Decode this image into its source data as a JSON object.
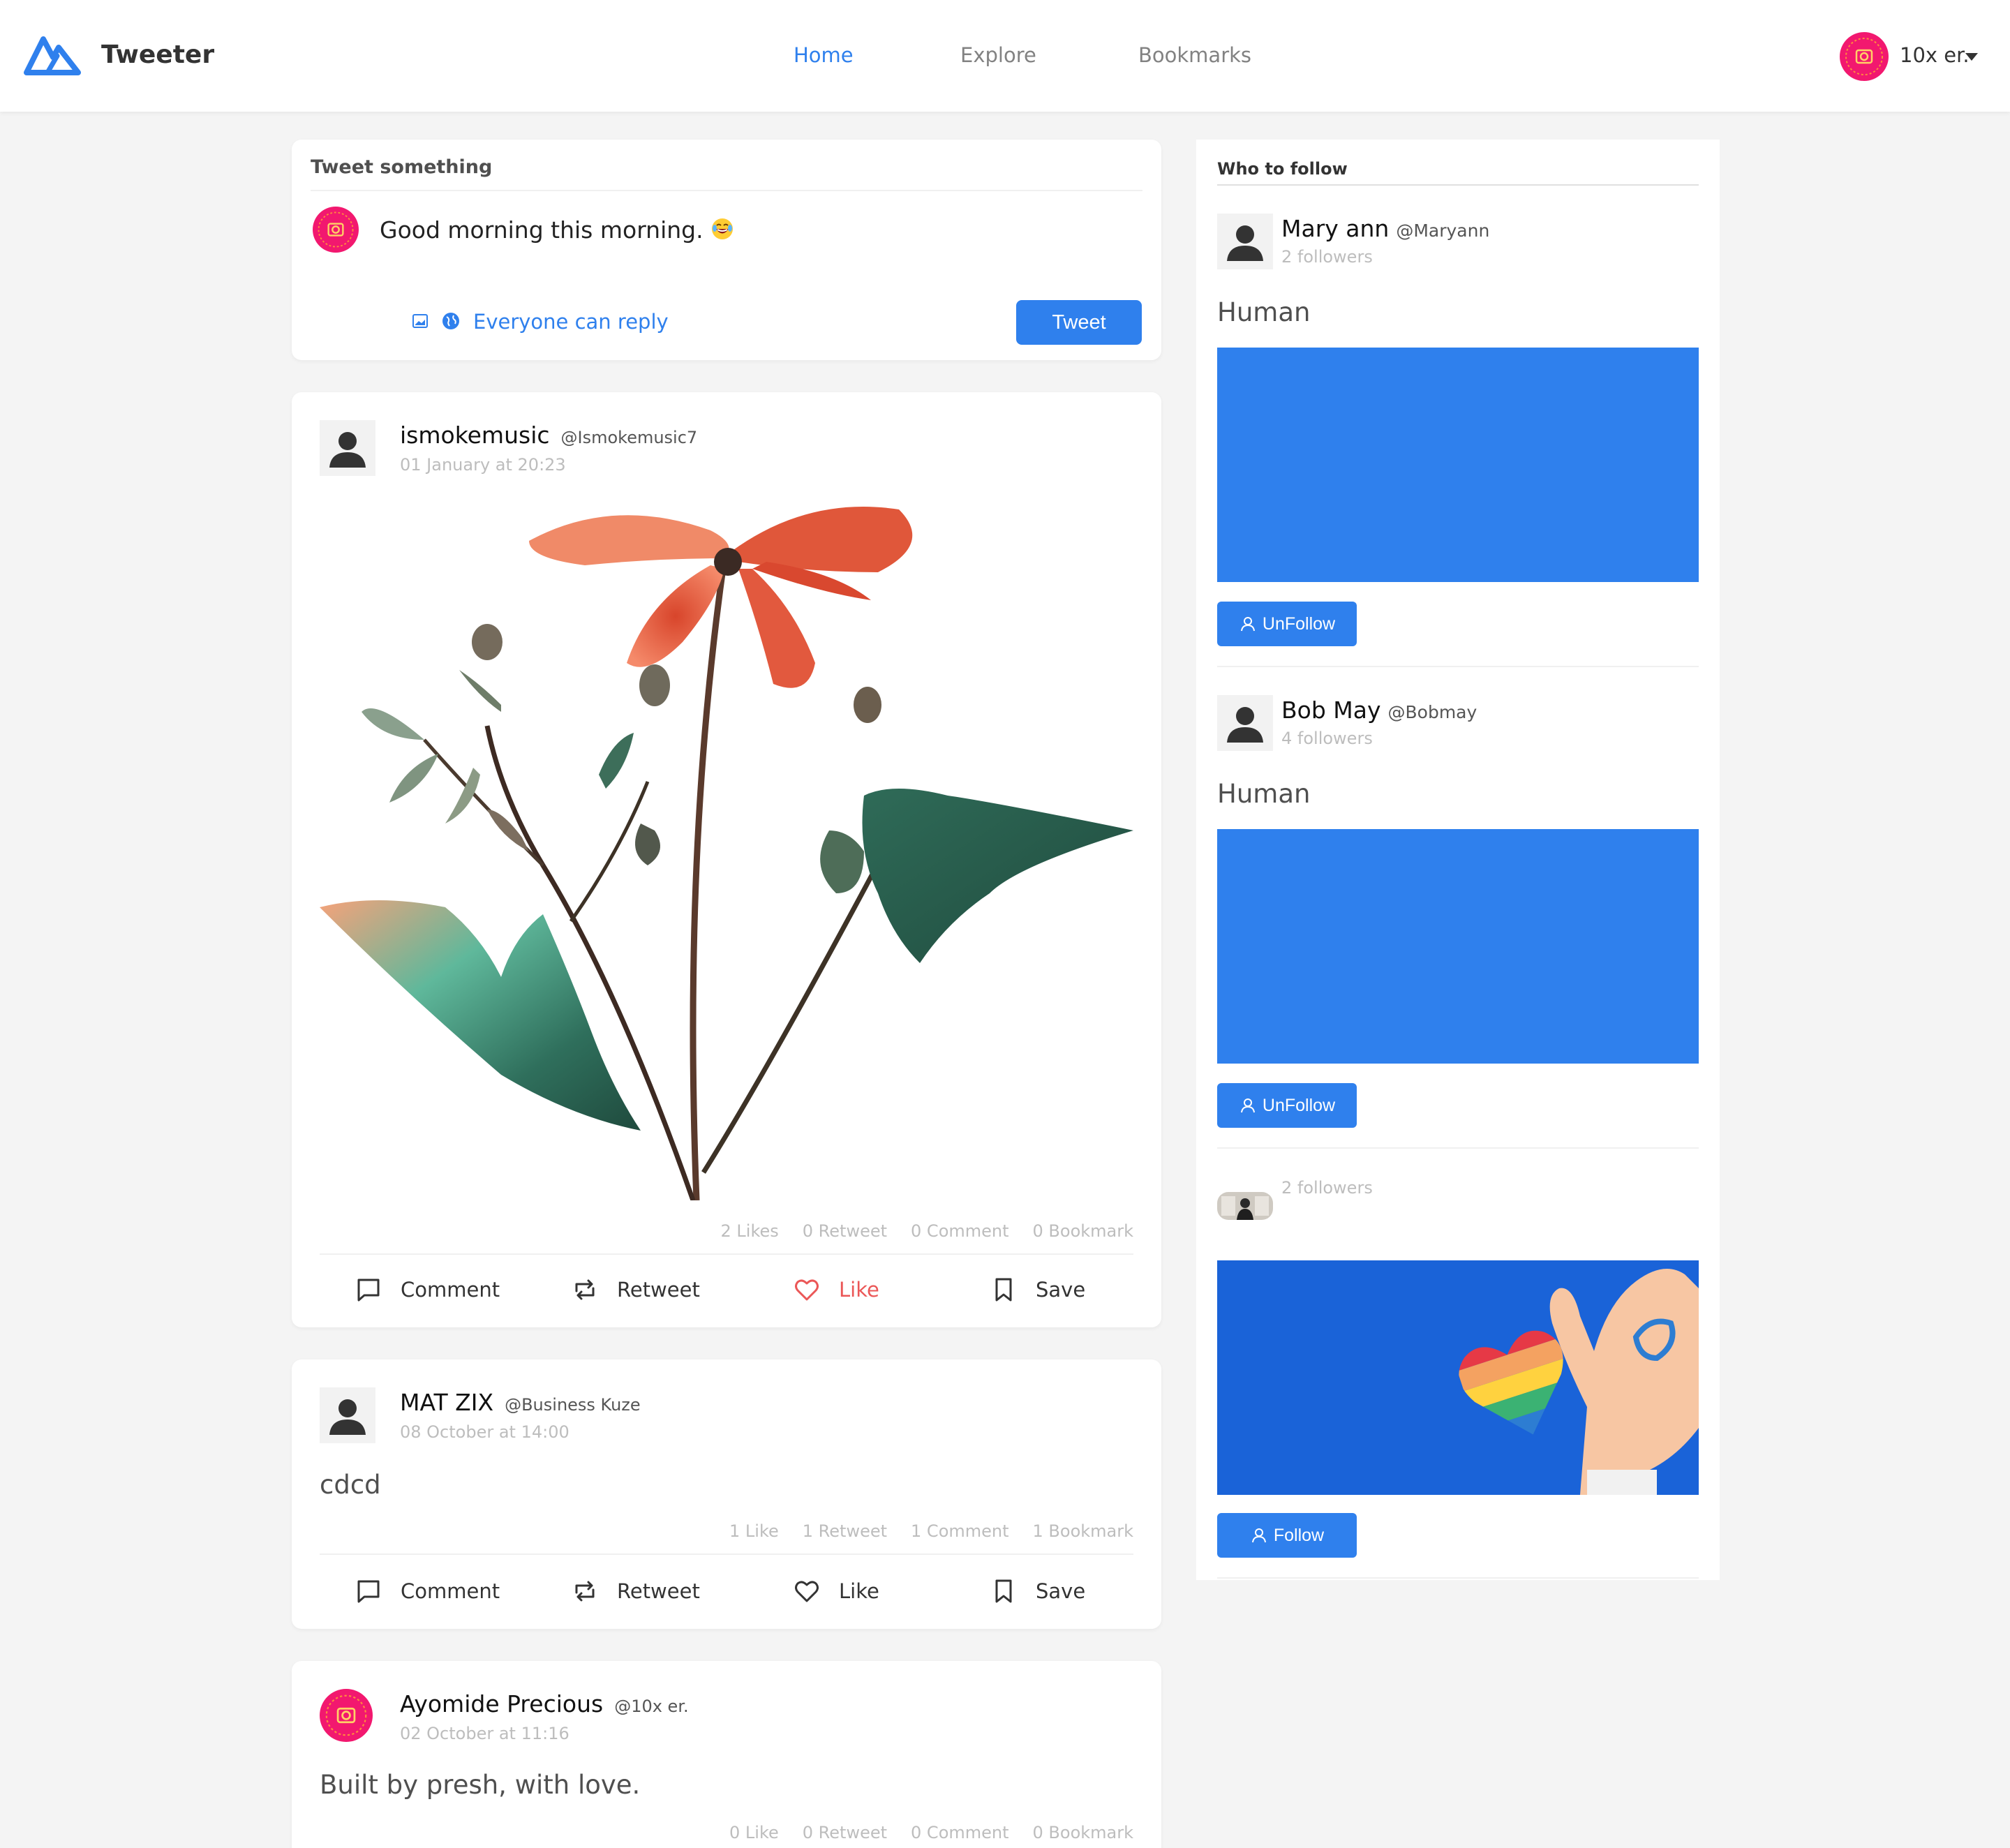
{
  "app": {
    "brand": "Tweeter",
    "nav": {
      "home": "Home",
      "explore": "Explore",
      "bookmarks": "Bookmarks"
    },
    "user_name": "10x er."
  },
  "compose": {
    "title": "Tweet something",
    "text": "Good morning this morning.",
    "reply_label": "Everyone can reply",
    "tweet_button": "Tweet"
  },
  "posts": [
    {
      "name": "ismokemusic",
      "handle": "@Ismokemusic7",
      "date": "01 January at 20:23",
      "stats": {
        "likes": "2 Likes",
        "retweets": "0 Retweet",
        "comments": "0 Comment",
        "bookmarks": "0 Bookmark"
      }
    },
    {
      "name": "MAT ZIX",
      "handle": "@Business Kuze",
      "date": "08 October at 14:00",
      "text": "cdcd",
      "stats": {
        "likes": "1 Like",
        "retweets": "1 Retweet",
        "comments": "1 Comment",
        "bookmarks": "1 Bookmark"
      }
    },
    {
      "name": "Ayomide Precious",
      "handle": "@10x er.",
      "date": "02 October at 11:16",
      "text": "Built by presh, with love.",
      "stats": {
        "likes": "0 Like",
        "retweets": "0 Retweet",
        "comments": "0 Comment",
        "bookmarks": "0 Bookmark"
      }
    }
  ],
  "actions": {
    "comment": "Comment",
    "retweet": "Retweet",
    "like": "Like",
    "save": "Save"
  },
  "who_to_follow": {
    "title": "Who to follow",
    "people": [
      {
        "name": "Mary ann",
        "handle": "@Maryann",
        "followers": "2 followers",
        "bio": "Human",
        "button": "UnFollow"
      },
      {
        "name": "Bob May",
        "handle": "@Bobmay",
        "followers": "4 followers",
        "bio": "Human",
        "button": "UnFollow"
      },
      {
        "name": "",
        "handle": "",
        "followers": "2 followers",
        "bio": "",
        "button": "Follow"
      }
    ]
  },
  "colors": {
    "accent": "#2f80ed",
    "like_red": "#eb5757",
    "avatar_pink": "#f2186f"
  }
}
